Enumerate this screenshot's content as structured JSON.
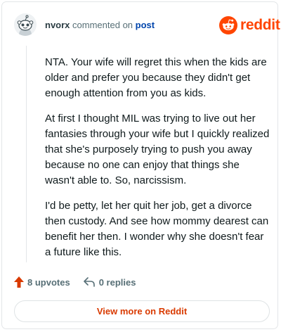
{
  "header": {
    "username": "nvorx",
    "action_text": "commented on",
    "post_link": "post"
  },
  "brand": {
    "logo_icon": "reddit-snoo-icon",
    "wordmark": "reddit",
    "color": "#ff4500"
  },
  "comment": {
    "paragraphs": [
      "NTA. Your wife will regret this when the kids are older and prefer you because they didn't get enough attention from you as kids.",
      "At first I thought MIL was trying to live out her fantasies through your wife but I quickly realized that she's purposely trying to push you away because no one can enjoy that things she wasn't able to. So, narcissism.",
      "I'd be petty, let her quit her job, get a divorce then custody. And see how mommy dearest can benefit her then. I wonder why she doesn't fear a future like this."
    ]
  },
  "actions": {
    "upvote_icon": "upvote-arrow-icon",
    "upvotes_label": "8 upvotes",
    "reply_icon": "reply-arrow-icon",
    "replies_label": "0 replies"
  },
  "footer": {
    "view_more_label": "View more on Reddit"
  }
}
